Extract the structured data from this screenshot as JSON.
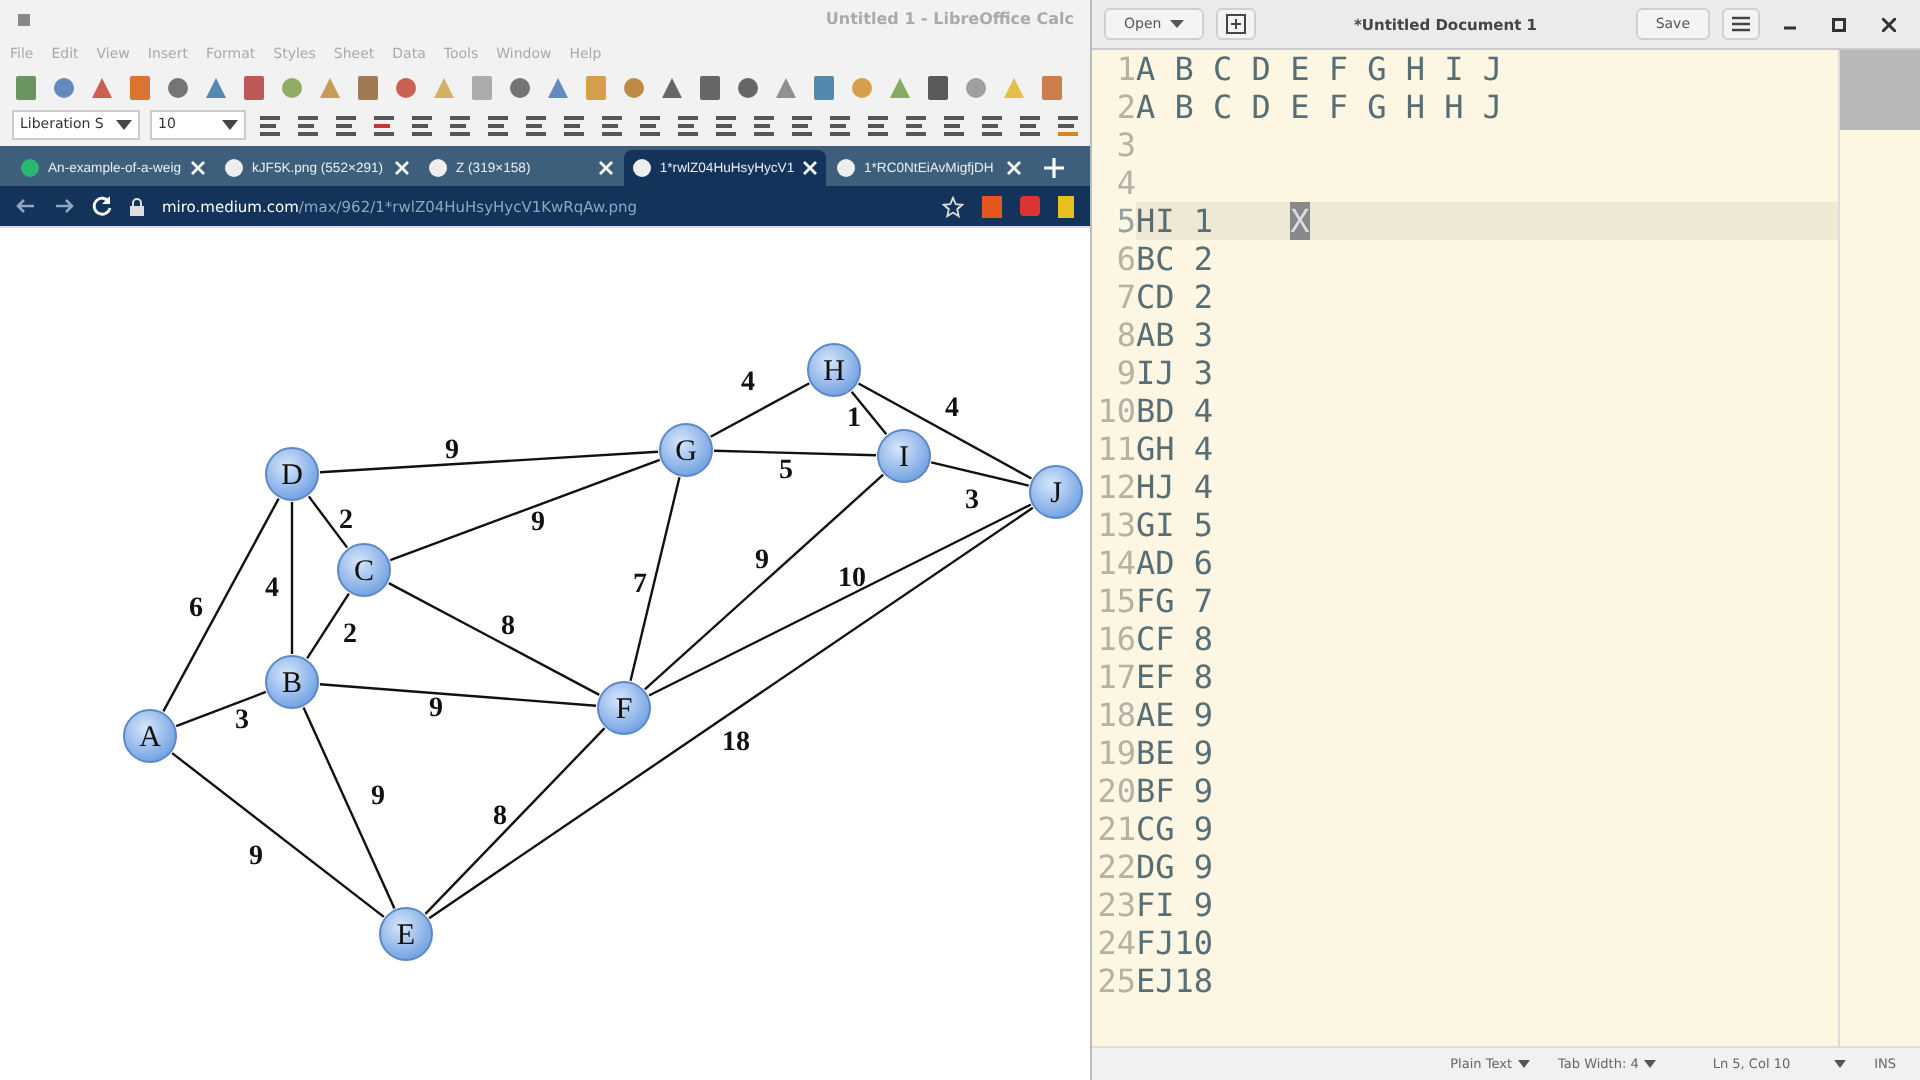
{
  "calc_window": {
    "title": "Untitled 1 - LibreOffice Calc",
    "menu": [
      "File",
      "Edit",
      "View",
      "Insert",
      "Format",
      "Styles",
      "Sheet",
      "Data",
      "Tools",
      "Window",
      "Help"
    ],
    "font_name": "Liberation S",
    "font_size": "10"
  },
  "browser": {
    "tabs": [
      {
        "label": "An-example-of-a-weig",
        "selected": false
      },
      {
        "label": "kJF5K.png (552×291)",
        "selected": false
      },
      {
        "label": "Z (319×158)",
        "selected": false
      },
      {
        "label": "1*rwlZ04HuHsyHycV1",
        "selected": true
      },
      {
        "label": "1*RC0NtEiAvMigfjDH",
        "selected": false
      }
    ],
    "address": {
      "domain": "miro.medium.com",
      "path": "/max/962/1*rwlZ04HuHsyHycV1KwRqAw.png"
    }
  },
  "graph": {
    "nodes": [
      {
        "label": "A"
      },
      {
        "label": "B"
      },
      {
        "label": "C"
      },
      {
        "label": "D"
      },
      {
        "label": "E"
      },
      {
        "label": "F"
      },
      {
        "label": "G"
      },
      {
        "label": "H"
      },
      {
        "label": "I"
      },
      {
        "label": "J"
      }
    ],
    "edges": [
      {
        "weight": "9"
      },
      {
        "weight": "4"
      },
      {
        "weight": "1"
      },
      {
        "weight": "4"
      },
      {
        "weight": "5"
      },
      {
        "weight": "3"
      },
      {
        "weight": "2"
      },
      {
        "weight": "9"
      },
      {
        "weight": "4"
      },
      {
        "weight": "6"
      },
      {
        "weight": "8"
      },
      {
        "weight": "2"
      },
      {
        "weight": "7"
      },
      {
        "weight": "9"
      },
      {
        "weight": "10"
      },
      {
        "weight": "3"
      },
      {
        "weight": "9"
      },
      {
        "weight": "18"
      },
      {
        "weight": "9"
      },
      {
        "weight": "8"
      },
      {
        "weight": "9"
      }
    ]
  },
  "editor": {
    "open_button": "Open",
    "title": "*Untitled Document 1",
    "save_button": "Save",
    "lines": [
      {
        "number": "1",
        "text": "A B C D E F G H I J",
        "current": false
      },
      {
        "number": "2",
        "text": "A B C D E F G H H J",
        "current": false
      },
      {
        "number": "3",
        "current": false
      },
      {
        "number": "4",
        "current": false
      },
      {
        "number": "5",
        "text": "HI 1    ",
        "selected_text": "X",
        "current": true
      },
      {
        "number": "6",
        "text": "BC 2",
        "current": false
      },
      {
        "number": "7",
        "text": "CD 2",
        "current": false
      },
      {
        "number": "8",
        "text": "AB 3",
        "current": false
      },
      {
        "number": "9",
        "text": "IJ 3",
        "current": false
      },
      {
        "number": "10",
        "text": "BD 4",
        "current": false
      },
      {
        "number": "11",
        "text": "GH 4",
        "current": false
      },
      {
        "number": "12",
        "text": "HJ 4",
        "current": false
      },
      {
        "number": "13",
        "text": "GI 5",
        "current": false
      },
      {
        "number": "14",
        "text": "AD 6",
        "current": false
      },
      {
        "number": "15",
        "text": "FG 7",
        "current": false
      },
      {
        "number": "16",
        "text": "CF 8",
        "current": false
      },
      {
        "number": "17",
        "text": "EF 8",
        "current": false
      },
      {
        "number": "18",
        "text": "AE 9",
        "current": false
      },
      {
        "number": "19",
        "text": "BE 9",
        "current": false
      },
      {
        "number": "20",
        "text": "BF 9",
        "current": false
      },
      {
        "number": "21",
        "text": "CG 9",
        "current": false
      },
      {
        "number": "22",
        "text": "DG 9",
        "current": false
      },
      {
        "number": "23",
        "text": "FI 9",
        "current": false
      },
      {
        "number": "24",
        "text": "FJ10",
        "current": false
      },
      {
        "number": "25",
        "text": "EJ18",
        "current": false
      }
    ],
    "status_bar": {
      "language": "Plain Text",
      "tab_width": "Tab Width: 4",
      "position": "Ln 5, Col 10",
      "mode": "INS"
    }
  }
}
